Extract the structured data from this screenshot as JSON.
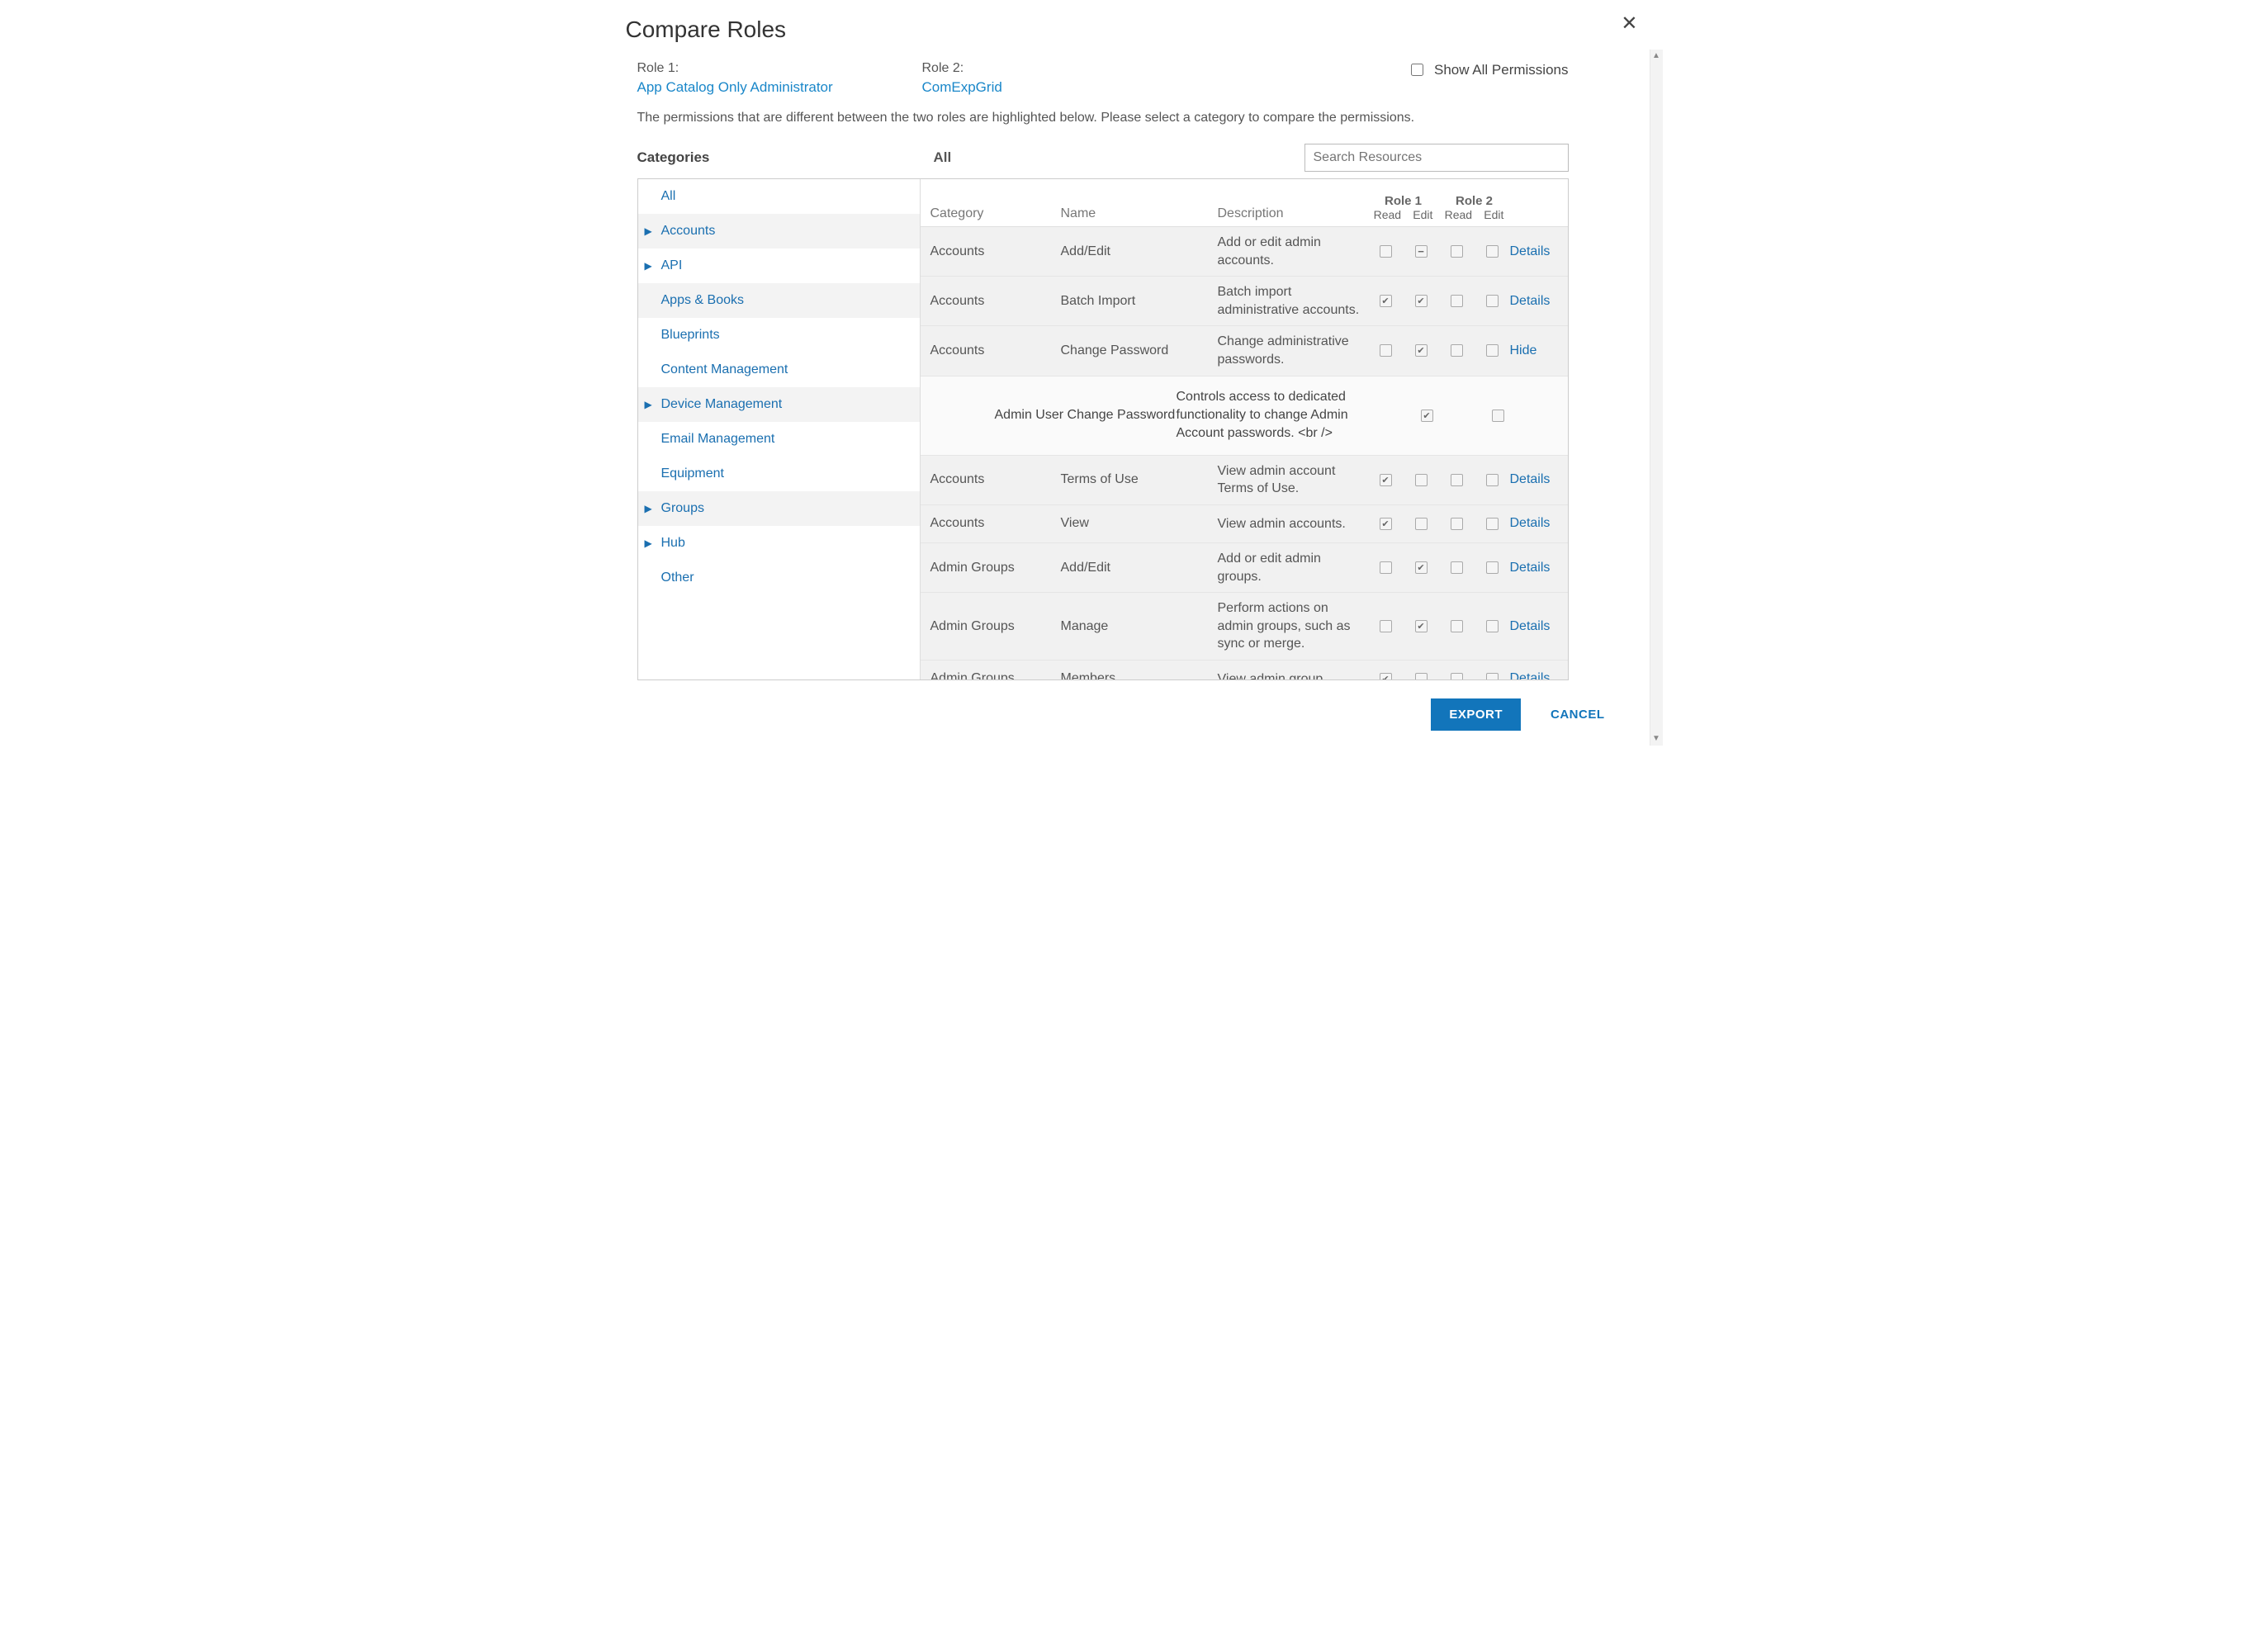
{
  "title": "Compare Roles",
  "role1_label": "Role 1:",
  "role1_name": "App Catalog Only Administrator",
  "role2_label": "Role 2:",
  "role2_name": "ComExpGrid",
  "show_all_label": "Show All Permissions",
  "show_all_checked": false,
  "instruction": "The permissions that are different between the two roles are highlighted below. Please select a category to compare the permissions.",
  "categories_header": "Categories",
  "all_header": "All",
  "search_placeholder": "Search Resources",
  "grid_headers": {
    "category": "Category",
    "name": "Name",
    "description": "Description",
    "role1": "Role 1",
    "role2": "Role 2",
    "read": "Read",
    "edit": "Edit"
  },
  "categories": [
    {
      "label": "All",
      "expandable": false,
      "alt": false
    },
    {
      "label": "Accounts",
      "expandable": true,
      "alt": true
    },
    {
      "label": "API",
      "expandable": true,
      "alt": false
    },
    {
      "label": "Apps & Books",
      "expandable": false,
      "alt": true
    },
    {
      "label": "Blueprints",
      "expandable": false,
      "alt": false
    },
    {
      "label": "Content Management",
      "expandable": false,
      "alt": false
    },
    {
      "label": "Device Management",
      "expandable": true,
      "alt": true
    },
    {
      "label": "Email Management",
      "expandable": false,
      "alt": false
    },
    {
      "label": "Equipment",
      "expandable": false,
      "alt": false
    },
    {
      "label": "Groups",
      "expandable": true,
      "alt": true
    },
    {
      "label": "Hub",
      "expandable": true,
      "alt": false
    },
    {
      "label": "Other",
      "expandable": false,
      "alt": false
    }
  ],
  "rows": [
    {
      "type": "row",
      "category": "Accounts",
      "name": "Add/Edit",
      "description": "Add or edit admin accounts.",
      "r1_read": "empty",
      "r1_edit": "indet",
      "r2_read": "empty",
      "r2_edit": "empty",
      "link": "Details"
    },
    {
      "type": "row",
      "category": "Accounts",
      "name": "Batch Import",
      "description": "Batch import administrative accounts.",
      "r1_read": "checked",
      "r1_edit": "checked",
      "r2_read": "empty",
      "r2_edit": "empty",
      "link": "Details"
    },
    {
      "type": "row",
      "category": "Accounts",
      "name": "Change Password",
      "description": "Change administrative passwords.",
      "r1_read": "empty",
      "r1_edit": "checked",
      "r2_read": "empty",
      "r2_edit": "empty",
      "link": "Hide"
    },
    {
      "type": "expanded",
      "name": "Admin User Change Password",
      "description": "Controls access to dedicated functionality to change Admin Account passwords. <br />",
      "c1": "checked",
      "c2": "empty"
    },
    {
      "type": "row",
      "category": "Accounts",
      "name": "Terms of Use",
      "description": "View admin account Terms of Use.",
      "r1_read": "checked",
      "r1_edit": "empty",
      "r2_read": "empty",
      "r2_edit": "empty",
      "link": "Details"
    },
    {
      "type": "row",
      "category": "Accounts",
      "name": "View",
      "description": "View admin accounts.",
      "r1_read": "checked",
      "r1_edit": "empty",
      "r2_read": "empty",
      "r2_edit": "empty",
      "link": "Details"
    },
    {
      "type": "row",
      "category": "Admin Groups",
      "name": "Add/Edit",
      "description": "Add or edit admin groups.",
      "r1_read": "empty",
      "r1_edit": "checked",
      "r2_read": "empty",
      "r2_edit": "empty",
      "link": "Details"
    },
    {
      "type": "row",
      "category": "Admin Groups",
      "name": "Manage",
      "description": "Perform actions on admin groups, such as sync or merge.",
      "r1_read": "empty",
      "r1_edit": "checked",
      "r2_read": "empty",
      "r2_edit": "empty",
      "link": "Details"
    },
    {
      "type": "row",
      "category": "Admin Groups",
      "name": "Members",
      "description": "View admin group",
      "r1_read": "checked",
      "r1_edit": "empty",
      "r2_read": "empty",
      "r2_edit": "empty",
      "link": "Details"
    }
  ],
  "footer": {
    "export": "EXPORT",
    "cancel": "CANCEL"
  }
}
